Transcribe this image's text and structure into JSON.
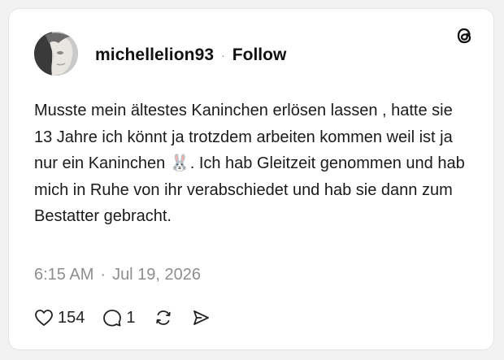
{
  "post": {
    "username": "michellelion93",
    "separator": "·",
    "follow_label": "Follow",
    "text_before_emoji": "Musste mein ältestes Kaninchen erlösen lassen , hatte sie 13 Jahre ich könnt ja trotzdem arbeiten kommen weil ist ja nur ein Kaninchen ",
    "emoji": "🐰",
    "text_after_emoji": ". Ich hab Gleitzeit genommen und hab mich in Ruhe von ihr verabschiedet und hab sie dann zum Bestatter gebracht.",
    "time": "6:15 AM",
    "date_separator": "·",
    "date": "Jul 19, 2026"
  },
  "stats": {
    "likes": "154",
    "replies": "1"
  },
  "icons": {
    "brand": "threads-logo-icon",
    "like": "heart-icon",
    "reply": "comment-bubble-icon",
    "repost": "repost-icon",
    "share": "send-icon"
  }
}
